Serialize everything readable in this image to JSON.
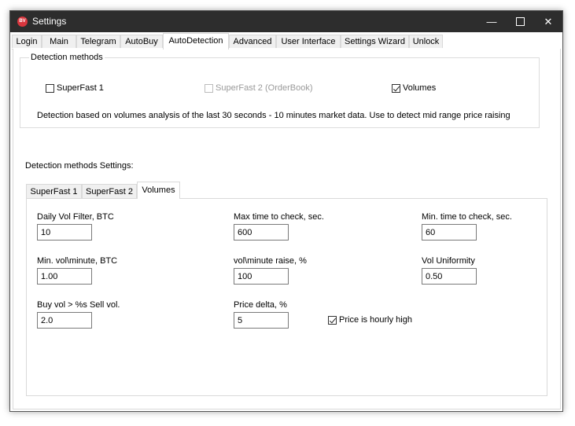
{
  "window": {
    "title": "Settings",
    "app_icon_text": "BV"
  },
  "tabs": [
    "Login",
    "Main",
    "Telegram",
    "AutoBuy",
    "AutoDetection",
    "Advanced",
    "User Interface",
    "Settings Wizard",
    "Unlock"
  ],
  "active_tab": "AutoDetection",
  "detection_methods": {
    "title": "Detection methods",
    "options": [
      {
        "label": "SuperFast 1",
        "checked": false,
        "enabled": true
      },
      {
        "label": "SuperFast 2 (OrderBook)",
        "checked": false,
        "enabled": false
      },
      {
        "label": "Volumes",
        "checked": true,
        "enabled": true
      }
    ],
    "description": "Detection based on volumes analysis of the last 30 seconds - 10 minutes market data. Use to detect mid range price raising"
  },
  "settings_label": "Detection methods Settings:",
  "subtabs": [
    "SuperFast 1",
    "SuperFast 2",
    "Volumes"
  ],
  "active_subtab": "Volumes",
  "fields": {
    "daily_vol_filter": {
      "label": "Daily Vol Filter,  BTC",
      "value": "10"
    },
    "max_time_check": {
      "label": "Max time to check, sec.",
      "value": "600"
    },
    "min_time_check": {
      "label": "Min. time to check, sec.",
      "value": "60"
    },
    "min_vol_minute": {
      "label": "Min. vol\\minute, BTC",
      "value": "1.00"
    },
    "vol_minute_raise": {
      "label": "vol\\minute raise, %",
      "value": "100"
    },
    "vol_uniformity": {
      "label": "Vol Uniformity",
      "value": "0.50"
    },
    "buy_vol_sell": {
      "label": "Buy vol > %s Sell vol.",
      "value": "2.0"
    },
    "price_delta": {
      "label": "Price delta, %",
      "value": "5"
    }
  },
  "price_hourly_high": {
    "label": "Price is hourly high",
    "checked": true
  }
}
